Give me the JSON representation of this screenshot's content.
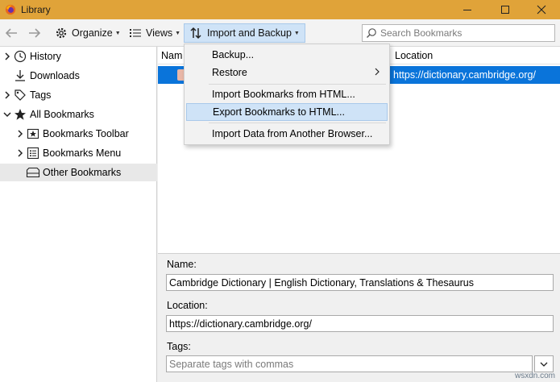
{
  "window": {
    "title": "Library",
    "accent": "#e0a339",
    "controls": [
      "minimize-icon",
      "maximize-icon",
      "close-icon"
    ]
  },
  "toolbar": {
    "organize_label": "Organize",
    "views_label": "Views",
    "import_backup_label": "Import and Backup",
    "search_placeholder": "Search Bookmarks"
  },
  "sidebar": {
    "items": [
      {
        "label": "History",
        "icon": "clock-icon",
        "expander": "collapsed"
      },
      {
        "label": "Downloads",
        "icon": "download-icon",
        "expander": "none"
      },
      {
        "label": "Tags",
        "icon": "tag-icon",
        "expander": "collapsed"
      },
      {
        "label": "All Bookmarks",
        "icon": "star-icon",
        "expander": "expanded"
      },
      {
        "label": "Bookmarks Toolbar",
        "icon": "bookmark-toolbar-icon",
        "expander": "collapsed"
      },
      {
        "label": "Bookmarks Menu",
        "icon": "bookmarks-menu-icon",
        "expander": "collapsed"
      },
      {
        "label": "Other Bookmarks",
        "icon": "folder-icon",
        "expander": "none",
        "selected": true
      }
    ]
  },
  "list": {
    "columns": [
      "Name",
      "Location"
    ],
    "column_name_visible": "Nam",
    "selected_row_location": "https://dictionary.cambridge.org/",
    "selection_color": "#0a74da"
  },
  "import_menu": {
    "items": [
      {
        "label": "Backup...",
        "has_submenu": false
      },
      {
        "label": "Restore",
        "has_submenu": true
      },
      {
        "label": "Import Bookmarks from HTML...",
        "has_submenu": false
      },
      {
        "label": "Export Bookmarks to HTML...",
        "has_submenu": false,
        "highlighted": true
      },
      {
        "label": "Import Data from Another Browser...",
        "has_submenu": false
      }
    ]
  },
  "details": {
    "name_label": "Name:",
    "name_value": "Cambridge Dictionary | English Dictionary, Translations & Thesaurus",
    "location_label": "Location:",
    "location_value": "https://dictionary.cambridge.org/",
    "tags_label": "Tags:",
    "tags_placeholder": "Separate tags with commas"
  },
  "watermark": "wsxdn.com"
}
